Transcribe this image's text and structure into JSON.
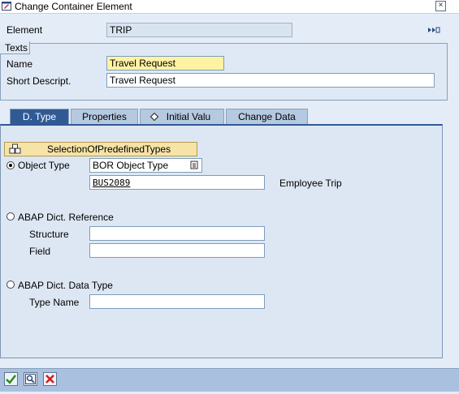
{
  "window": {
    "title": "Change Container Element",
    "close": "×"
  },
  "element": {
    "label": "Element",
    "value": "TRIP",
    "nav_icon": "arrow-right-icon"
  },
  "texts_group": {
    "title": "Texts",
    "name_label": "Name",
    "name_value": "Travel Request",
    "short_label": "Short Descript.",
    "short_value": "Travel Request"
  },
  "tabs": [
    {
      "label": "D. Type",
      "active": true
    },
    {
      "label": "Properties",
      "active": false
    },
    {
      "label": "Initial Valu",
      "active": false
    },
    {
      "label": "Change Data",
      "active": false
    }
  ],
  "dtype": {
    "select_button": "SelectionOfPredefinedTypes",
    "object_type": {
      "label": "Object Type",
      "selected": true,
      "category": "BOR Object Type",
      "value": "BUS2089",
      "description": "Employee Trip"
    },
    "abap_ref": {
      "label": "ABAP Dict. Reference",
      "selected": false,
      "structure_label": "Structure",
      "structure_value": "",
      "field_label": "Field",
      "field_value": ""
    },
    "abap_type": {
      "label": "ABAP Dict. Data Type",
      "selected": false,
      "type_label": "Type Name",
      "type_value": ""
    }
  },
  "toolbar": {
    "icons": [
      "checkmark-icon",
      "inspect-icon",
      "cancel-icon"
    ]
  },
  "colors": {
    "accent": "#2f5a94",
    "highlight": "#fff3a3"
  }
}
